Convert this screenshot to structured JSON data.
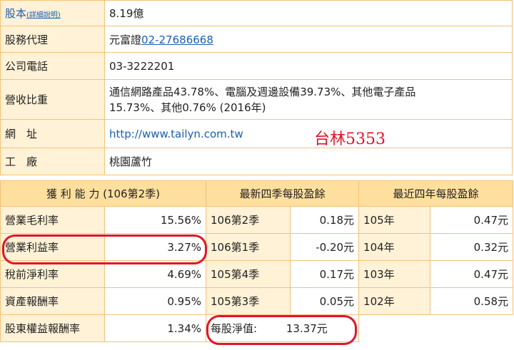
{
  "info": {
    "share_label": "股本",
    "share_link": "(詳細說明)",
    "share_value": "8.19億",
    "agent_label": "股務代理",
    "agent_value": "元富證",
    "agent_phone": "02-27686668",
    "phone_label": "公司電話",
    "phone_value": "03-3222201",
    "revenue_label": "營收比重",
    "revenue_line1": "通信網路產品43.78%、電腦及週邊設備39.73%、其他電子產品",
    "revenue_line2": "15.73%、其他0.76% (2016年)",
    "url_label": "網　址",
    "url_value": "http://www.tailyn.com.tw",
    "factory_label": "工　廠",
    "factory_value": "桃園蘆竹"
  },
  "annotation": "台林5353",
  "stats": {
    "headers": [
      "獲 利 能 力 (106第2季)",
      "最新四季每股盈餘",
      "最近四年每股盈餘"
    ],
    "rows": [
      [
        "營業毛利率",
        "15.56%",
        "106第2季",
        "0.18元",
        "105年",
        "0.47元"
      ],
      [
        "營業利益率",
        "3.27%",
        "106第1季",
        "-0.20元",
        "104年",
        "0.32元"
      ],
      [
        "稅前淨利率",
        "4.69%",
        "105第4季",
        "0.17元",
        "103年",
        "0.47元"
      ],
      [
        "資產報酬率",
        "0.95%",
        "105第3季",
        "0.05元",
        "102年",
        "0.58元"
      ]
    ],
    "last_row": {
      "label": "股東權益報酬率",
      "value": "1.34%",
      "nav_label": "每股淨值:",
      "nav_value": "13.37元"
    }
  }
}
